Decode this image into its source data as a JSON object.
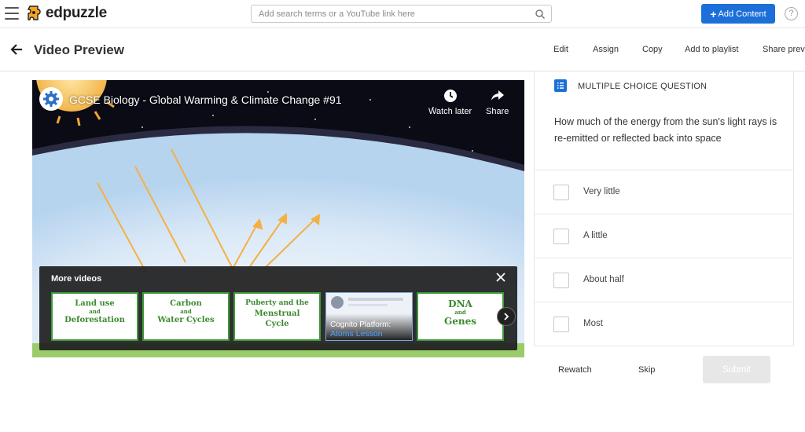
{
  "nav": {
    "logo_text": "edpuzzle",
    "search_placeholder": "Add search terms or a YouTube link here",
    "add_content_label": "Add Content",
    "help_label": "?"
  },
  "header": {
    "title": "Video Preview",
    "actions": [
      "Edit",
      "Assign",
      "Copy",
      "Add to playlist",
      "Share previ"
    ]
  },
  "video": {
    "title": "GCSE Biology - Global Warming & Climate Change #91",
    "watch_later": "Watch later",
    "share": "Share",
    "more_videos_label": "More videos",
    "thumbs": [
      {
        "line1": "Land use",
        "line2": "and",
        "line3": "Deforestation"
      },
      {
        "line1": "Carbon",
        "line2": "and",
        "line3": "Water Cycles"
      },
      {
        "line1": "Puberty and the",
        "line2": "Menstrual",
        "line3": "Cycle"
      },
      {
        "line1": "Cognito Platform:",
        "line2": "Atoms Lesson",
        "line3": ""
      },
      {
        "line1": "DNA",
        "line2": "and",
        "line3": "Genes"
      }
    ]
  },
  "question": {
    "type_label": "MULTIPLE CHOICE QUESTION",
    "text": "How much of the energy from the sun's light rays is re-emitted or reflected back into space",
    "options": [
      "Very little",
      "A little",
      "About half",
      "Most"
    ]
  },
  "actions": {
    "rewatch": "Rewatch",
    "skip": "Skip",
    "submit": "Submit"
  },
  "colors": {
    "primary": "#1c6fd8",
    "thumb_border": "#3d9a3a",
    "logo_orange": "#f6a623"
  }
}
